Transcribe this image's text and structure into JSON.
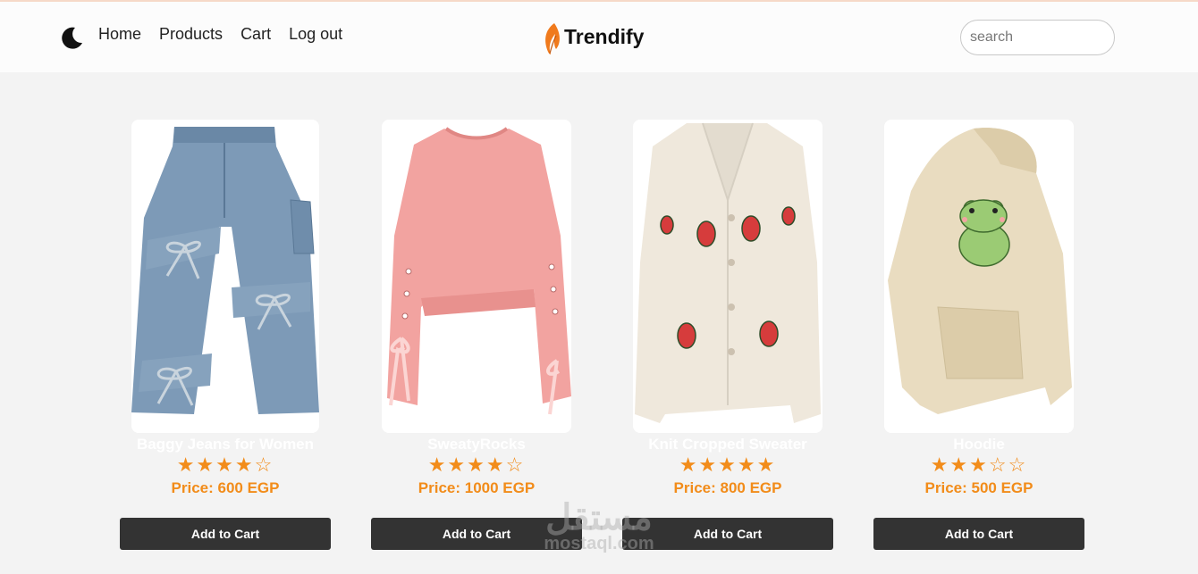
{
  "header": {
    "theme_toggle_icon": "moon-icon",
    "nav": [
      "Home",
      "Products",
      "Cart",
      "Log out"
    ],
    "brand": "Trendify",
    "brand_icon": "flame-leaf-icon",
    "search_placeholder": "search"
  },
  "products": [
    {
      "name": "Baggy Jeans for Women",
      "rating": 4,
      "stars": "★★★★☆",
      "price": "Price: 600 EGP",
      "button": "Add to Cart",
      "image": "baggy-jeans-image"
    },
    {
      "name": "SweatyRocks",
      "rating": 4,
      "stars": "★★★★☆",
      "price": "Price: 1000 EGP",
      "button": "Add to Cart",
      "image": "pink-sweatshirt-image"
    },
    {
      "name": "Knit Cropped Sweater",
      "rating": 5,
      "stars": "★★★★★",
      "price": "Price: 800 EGP",
      "button": "Add to Cart",
      "image": "strawberry-cardigan-image"
    },
    {
      "name": "Hoodie",
      "rating": 3,
      "stars": "★★★☆☆",
      "price": "Price: 500 EGP",
      "button": "Add to Cart",
      "image": "frog-hoodie-image"
    }
  ],
  "watermark": {
    "arabic": "مستقل",
    "latin": "mostaql.com"
  },
  "colors": {
    "accent": "#f28c1a",
    "button": "#333333",
    "background": "#f3f3f3"
  }
}
